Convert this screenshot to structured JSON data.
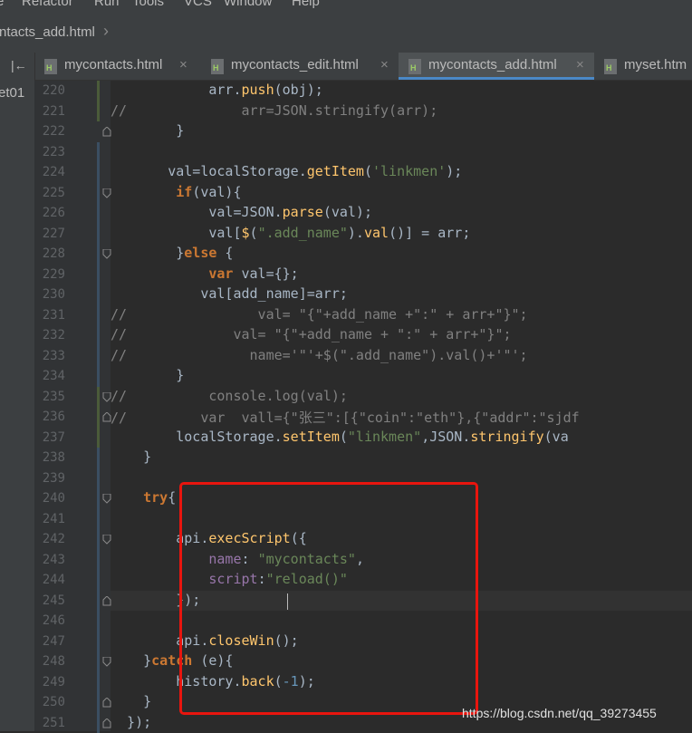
{
  "menu": [
    "e",
    "Refactor",
    "Run",
    "Tools",
    "VCS",
    "Window",
    "Help"
  ],
  "breadcrumb": "ntacts_add.html",
  "sidebar": {
    "project_label": "et01"
  },
  "tabs": [
    {
      "label": "mycontacts.html",
      "active": false
    },
    {
      "label": "mycontacts_edit.html",
      "active": false
    },
    {
      "label": "mycontacts_add.html",
      "active": true
    },
    {
      "label": "myset.htm",
      "active": false
    }
  ],
  "line_numbers": [
    "220",
    "221",
    "222",
    "223",
    "224",
    "225",
    "226",
    "227",
    "228",
    "229",
    "230",
    "231",
    "232",
    "233",
    "234",
    "235",
    "236",
    "237",
    "238",
    "239",
    "240",
    "241",
    "242",
    "243",
    "244",
    "245",
    "246",
    "247",
    "248",
    "249",
    "250",
    "251"
  ],
  "code_lines": [
    [
      [
        "",
        "            arr."
      ],
      [
        "fn",
        "push"
      ],
      [
        "",
        "(obj);"
      ]
    ],
    [
      [
        "cmt",
        "//              arr=JSON.stringify(arr);"
      ]
    ],
    [
      [
        "",
        "        }"
      ]
    ],
    [
      [
        "",
        ""
      ]
    ],
    [
      [
        "",
        "       val=localStorage."
      ],
      [
        "fn",
        "getItem"
      ],
      [
        "",
        "("
      ],
      [
        "str",
        "'linkmen'"
      ],
      [
        "",
        ");"
      ]
    ],
    [
      [
        "",
        "        "
      ],
      [
        "kw",
        "if"
      ],
      [
        "",
        "(val){"
      ]
    ],
    [
      [
        "",
        "            val=JSON."
      ],
      [
        "fn",
        "parse"
      ],
      [
        "",
        "(val);"
      ]
    ],
    [
      [
        "",
        "            val["
      ],
      [
        "fn",
        "$"
      ],
      [
        "",
        "("
      ],
      [
        "str",
        "\".add_name\""
      ],
      [
        "",
        ")."
      ],
      [
        "fn",
        "val"
      ],
      [
        "",
        "()] = arr;"
      ]
    ],
    [
      [
        "",
        "        }"
      ],
      [
        "kw",
        "else"
      ],
      [
        "",
        " {"
      ]
    ],
    [
      [
        "",
        "            "
      ],
      [
        "kw",
        "var"
      ],
      [
        "",
        " val={};"
      ]
    ],
    [
      [
        "",
        "           val[add_name]=arr;"
      ]
    ],
    [
      [
        "cmt",
        "//                val= \"{\"+add_name +\":\" + arr+\"}\";"
      ]
    ],
    [
      [
        "cmt",
        "//             val= \"{\"+add_name + \":\" + arr+\"}\";"
      ]
    ],
    [
      [
        "cmt",
        "//               name='\"'+$(\".add_name\").val()+'\"';"
      ]
    ],
    [
      [
        "",
        "        }"
      ]
    ],
    [
      [
        "cmt",
        "//          console.log(val);"
      ]
    ],
    [
      [
        "cmt",
        "//         var  vall={\"张三\":[{\"coin\":\"eth\"},{\"addr\":\"sjdf"
      ]
    ],
    [
      [
        "",
        "        localStorage."
      ],
      [
        "fn",
        "setItem"
      ],
      [
        "",
        "("
      ],
      [
        "str",
        "\"linkmen\""
      ],
      [
        "",
        ",JSON."
      ],
      [
        "fn",
        "stringify"
      ],
      [
        "",
        "(va"
      ]
    ],
    [
      [
        "",
        "    }"
      ]
    ],
    [
      [
        "",
        ""
      ]
    ],
    [
      [
        "",
        "    "
      ],
      [
        "kw",
        "try"
      ],
      [
        "",
        "{"
      ]
    ],
    [
      [
        "",
        ""
      ]
    ],
    [
      [
        "",
        "        api."
      ],
      [
        "fn",
        "execScript"
      ],
      [
        "",
        "({"
      ]
    ],
    [
      [
        "",
        "            "
      ],
      [
        "prop",
        "name"
      ],
      [
        "",
        ": "
      ],
      [
        "str",
        "\"mycontacts\""
      ],
      [
        "",
        ","
      ]
    ],
    [
      [
        "",
        "            "
      ],
      [
        "prop",
        "script"
      ],
      [
        "",
        ":"
      ],
      [
        "str",
        "\"reload()\""
      ]
    ],
    [
      [
        "",
        "        });"
      ]
    ],
    [
      [
        "",
        ""
      ]
    ],
    [
      [
        "",
        "        api."
      ],
      [
        "fn",
        "closeWin"
      ],
      [
        "",
        "();"
      ]
    ],
    [
      [
        "",
        "    }"
      ],
      [
        "kw",
        "catch"
      ],
      [
        "",
        " (e){"
      ]
    ],
    [
      [
        "",
        "        history."
      ],
      [
        "fn",
        "back"
      ],
      [
        "",
        "("
      ],
      [
        "num",
        "-1"
      ],
      [
        "",
        ");"
      ]
    ],
    [
      [
        "",
        "    }"
      ]
    ],
    [
      [
        "",
        "  });"
      ]
    ]
  ],
  "watermark": "https://blog.csdn.net/qq_39273455",
  "colors": {
    "editor_bg": "#2b2b2b",
    "keyword": "#cc7832",
    "function": "#ffc66d",
    "string": "#6a8759",
    "comment": "#808080",
    "highlight_box": "#e8150e",
    "active_tab_underline": "#4a88c7"
  }
}
